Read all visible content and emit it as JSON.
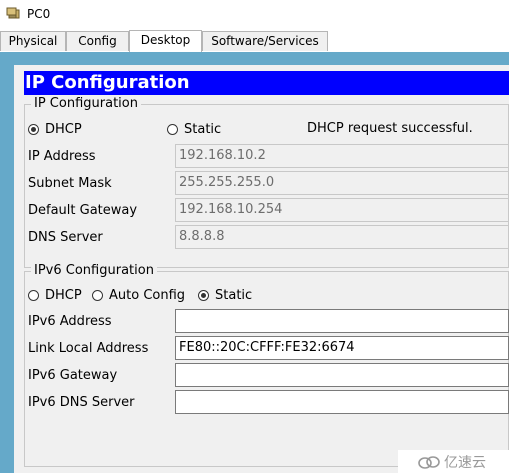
{
  "window": {
    "title": "PC0",
    "icon": "pc-icon"
  },
  "tabs": [
    {
      "label": "Physical"
    },
    {
      "label": "Config"
    },
    {
      "label": "Desktop",
      "active": true
    },
    {
      "label": "Software/Services"
    }
  ],
  "header": {
    "title": "IP Configuration"
  },
  "ipv4": {
    "legend": "IP Configuration",
    "dhcp_label": "DHCP",
    "static_label": "Static",
    "selected": "DHCP",
    "status": "DHCP request successful.",
    "fields": [
      {
        "label": "IP Address",
        "value": "192.168.10.2"
      },
      {
        "label": "Subnet Mask",
        "value": "255.255.255.0"
      },
      {
        "label": "Default Gateway",
        "value": "192.168.10.254"
      },
      {
        "label": "DNS Server",
        "value": "8.8.8.8"
      }
    ]
  },
  "ipv6": {
    "legend": "IPv6 Configuration",
    "dhcp_label": "DHCP",
    "autoconfig_label": "Auto Config",
    "static_label": "Static",
    "selected": "Static",
    "fields": [
      {
        "label": "IPv6 Address",
        "value": ""
      },
      {
        "label": "Link Local Address",
        "value": "FE80::20C:CFFF:FE32:6674"
      },
      {
        "label": "IPv6 Gateway",
        "value": ""
      },
      {
        "label": "IPv6 DNS Server",
        "value": ""
      }
    ]
  },
  "colors": {
    "header_bg": "#0000ff",
    "panel_bg": "#65a9c9",
    "inner_bg": "#f0f0f0"
  },
  "watermark": {
    "text": "亿速云"
  }
}
